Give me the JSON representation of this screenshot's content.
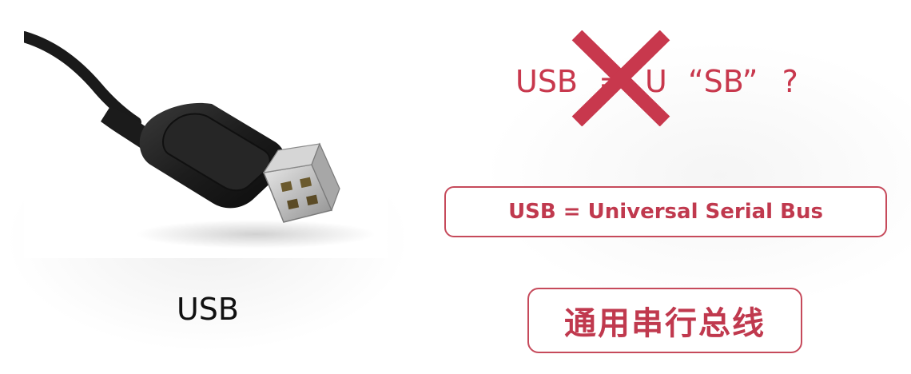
{
  "left": {
    "caption": "USB"
  },
  "right": {
    "wrong_guess": {
      "usb": "USB",
      "eq": "=",
      "u": "U",
      "sb": "“SB”",
      "question": "?"
    },
    "full_name": "USB = Universal Serial Bus",
    "chinese_name": "通用串行总线"
  },
  "colors": {
    "accent": "#c64a5b",
    "cross": "#c8384d",
    "text": "#111111"
  },
  "icons": {
    "cross": "cross-mark-icon",
    "usb_plug": "usb-plug-icon"
  }
}
